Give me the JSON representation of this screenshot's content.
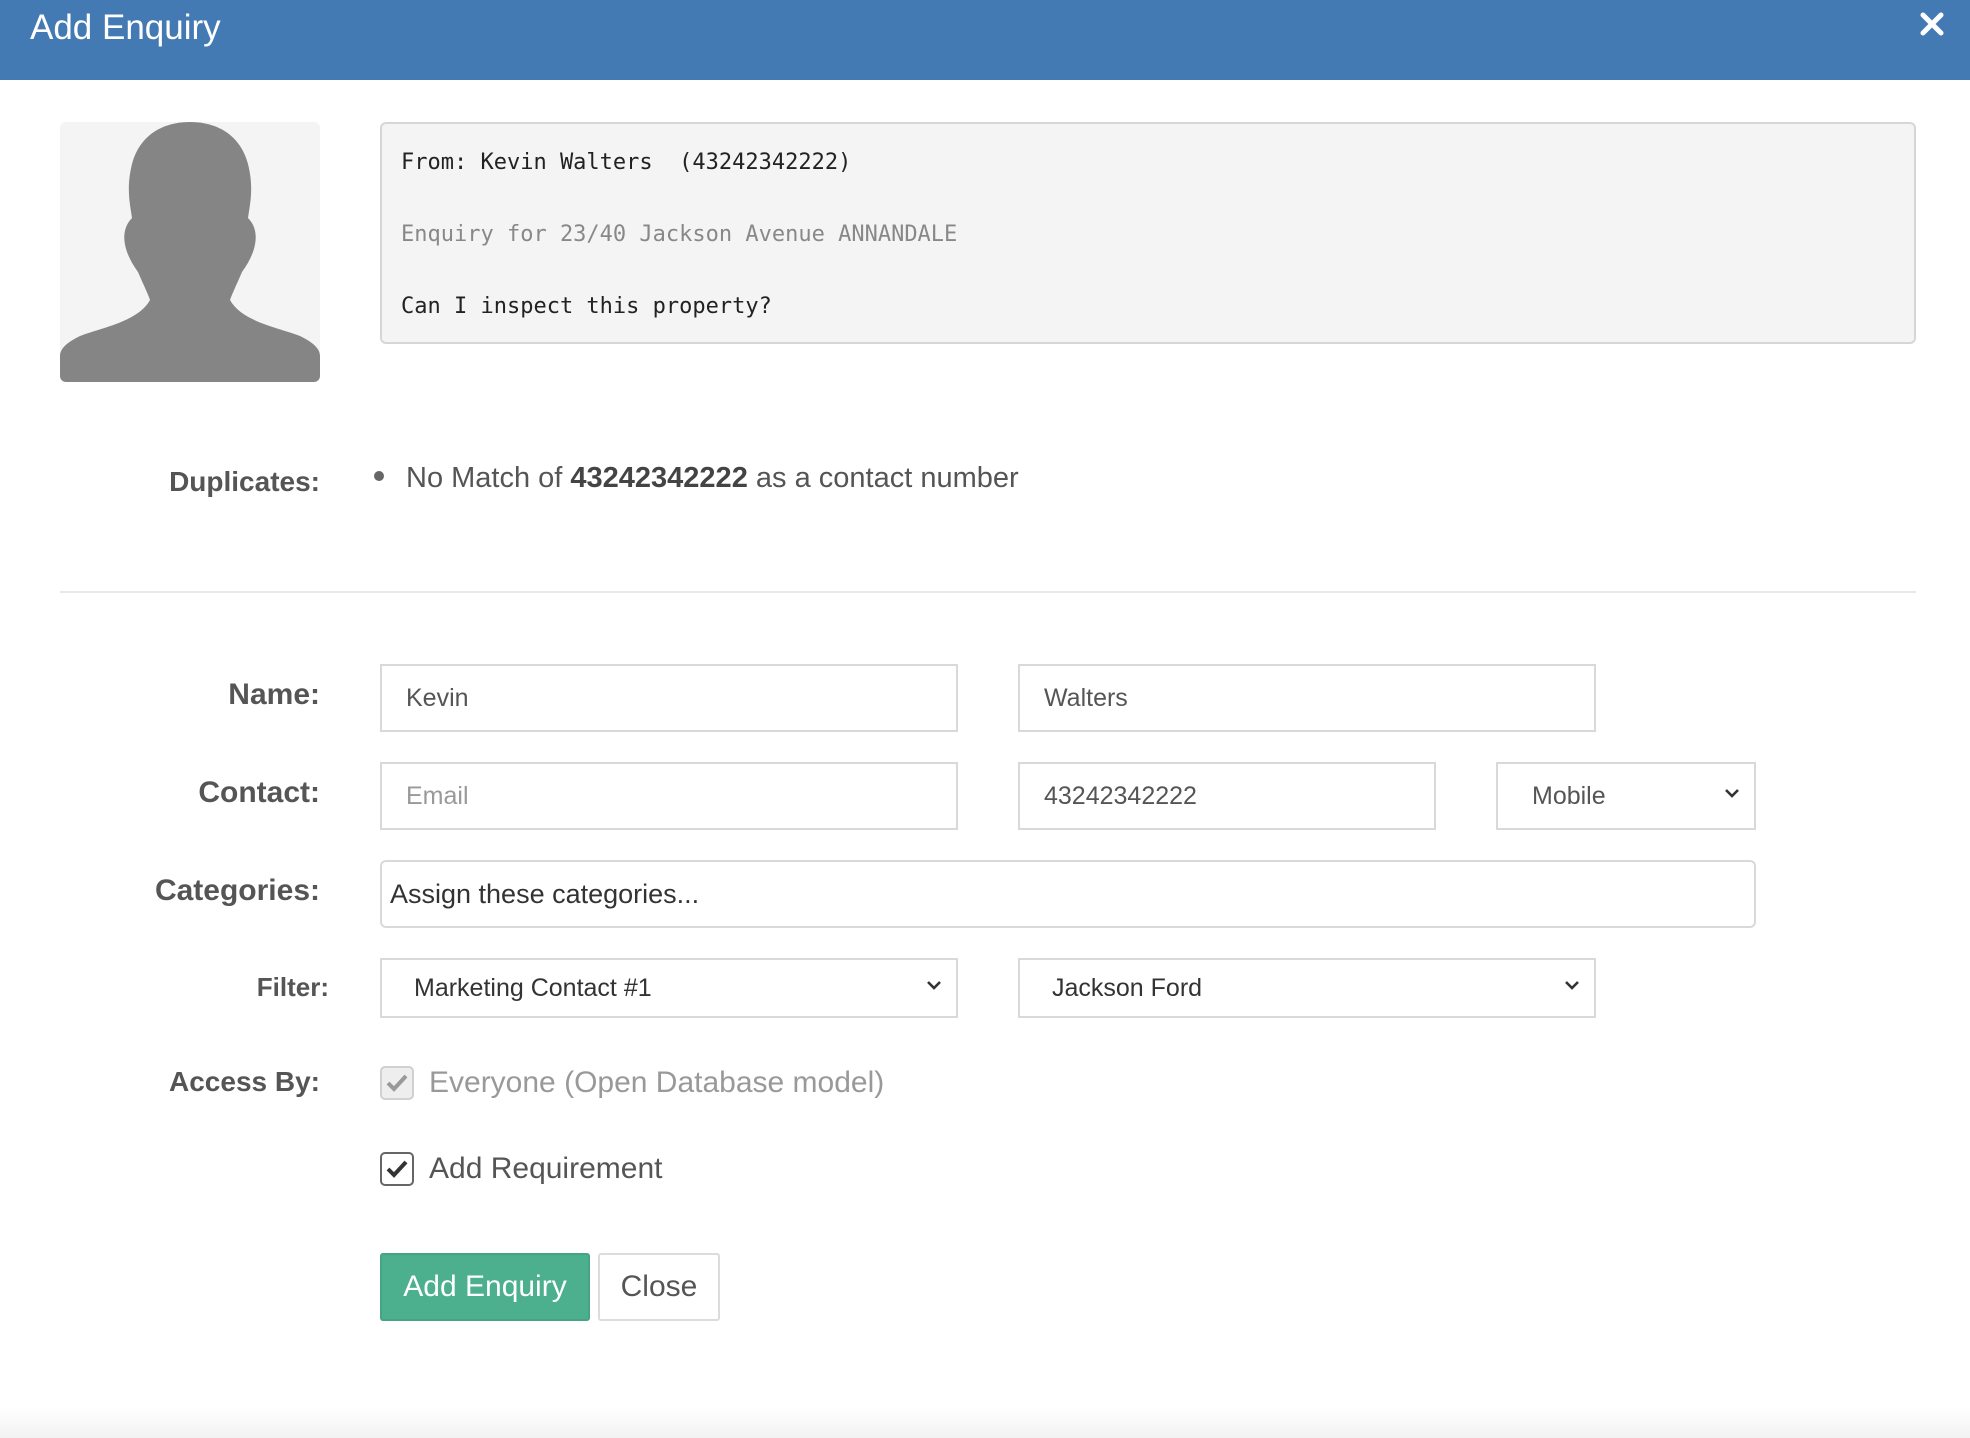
{
  "modal": {
    "title": "Add Enquiry"
  },
  "message": {
    "from": "From: Kevin Walters  (43242342222)",
    "property": "Enquiry for 23/40 Jackson Avenue ANNANDALE",
    "body": "Can I inspect this property?"
  },
  "duplicates": {
    "label": "Duplicates:",
    "prefix": "No Match of",
    "number": "43242342222",
    "suffix": "as a contact number"
  },
  "form": {
    "name_label": "Name:",
    "first_name": "Kevin",
    "last_name": "Walters",
    "contact_label": "Contact:",
    "email_placeholder": "Email",
    "phone": "43242342222",
    "phone_type": "Mobile",
    "categories_label": "Categories:",
    "categories_placeholder": "Assign these categories...",
    "filter_label": "Filter:",
    "filter_contact": "Marketing Contact #1",
    "filter_agent": "Jackson Ford",
    "access_label": "Access By:",
    "access_everyone": "Everyone (Open Database model)",
    "add_requirement": "Add Requirement"
  },
  "buttons": {
    "add": "Add Enquiry",
    "close": "Close"
  },
  "colors": {
    "header": "#437ab3",
    "primary_button": "#4caf8e"
  },
  "icons": {
    "close": "close-icon",
    "avatar": "user-silhouette-icon",
    "checkmark": "check-icon",
    "dropdown": "chevron-down-icon"
  }
}
